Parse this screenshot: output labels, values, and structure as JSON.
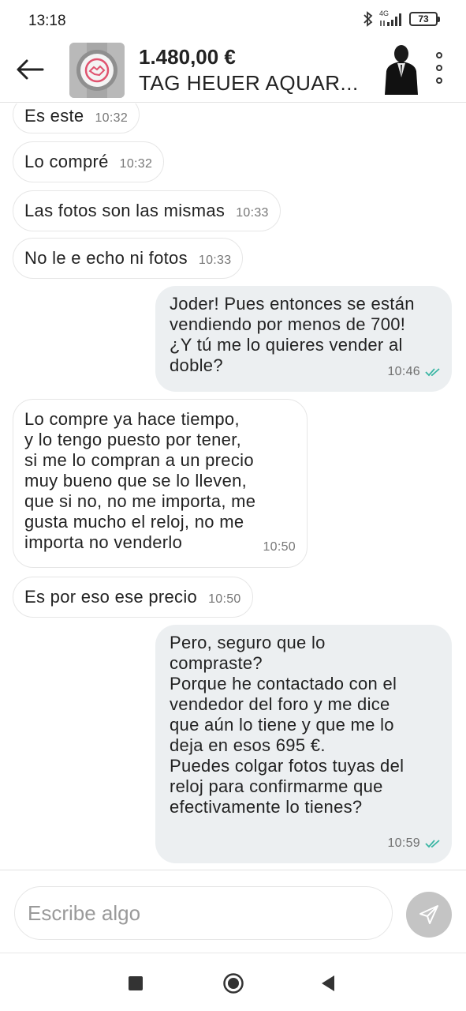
{
  "status_bar": {
    "time": "13:18",
    "network": "4G",
    "battery": "73",
    "icons": [
      "bluetooth-icon",
      "signal-icon",
      "battery-icon"
    ]
  },
  "header": {
    "price": "1.480,00 €",
    "title": "TAG HEUER AQUAR...",
    "back_icon": "arrow-left-icon",
    "menu_icon": "more-vertical-icon"
  },
  "messages": [
    {
      "direction": "in",
      "text": "Es este",
      "time": "10:32"
    },
    {
      "direction": "in",
      "text": "Lo compré",
      "time": "10:32"
    },
    {
      "direction": "in",
      "text": "Las fotos son las mismas",
      "time": "10:33"
    },
    {
      "direction": "in",
      "text": "No le e echo ni fotos",
      "time": "10:33"
    },
    {
      "direction": "out",
      "lines": [
        "Joder! Pues entonces se están",
        "vendiendo por menos de 700!",
        "¿Y tú me lo quieres vender al",
        "doble?"
      ],
      "time": "10:46",
      "status": "read"
    },
    {
      "direction": "in",
      "lines": [
        "Lo compre ya hace tiempo,",
        "y lo tengo puesto por tener,",
        "si me lo compran a un precio",
        "muy bueno que se lo lleven,",
        "que si no, no me importa, me",
        "gusta mucho el reloj, no me",
        "importa no venderlo"
      ],
      "time": "10:50"
    },
    {
      "direction": "in",
      "text": "Es por eso ese precio",
      "time": "10:50"
    },
    {
      "direction": "out",
      "lines": [
        "Pero, seguro que lo",
        "compraste?",
        "Porque he contactado con el",
        "vendedor del foro y me dice",
        "que aún lo tiene y que me lo",
        "deja en esos 695 €.",
        "Puedes colgar fotos tuyas del",
        "reloj para confirmarme  que",
        "efectivamente lo tienes?"
      ],
      "time": "10:59",
      "status": "read"
    }
  ],
  "composer": {
    "placeholder": "Escribe algo",
    "value": "",
    "send_icon": "send-icon"
  },
  "nav": {
    "icons": [
      "recents-square-icon",
      "home-circle-icon",
      "back-triangle-icon"
    ]
  },
  "colors": {
    "outgoing_bubble": "#eceff1",
    "incoming_bubble": "#ffffff",
    "read_check": "#3bb6a4",
    "send_button": "#c4c4c4",
    "logo_pink": "#e0536f"
  }
}
